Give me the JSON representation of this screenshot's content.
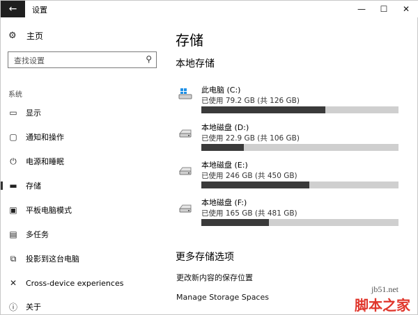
{
  "window": {
    "title": "设置",
    "back_icon": "arrow-left-icon",
    "controls": {
      "minimize": "—",
      "maximize": "☐",
      "close": "✕"
    }
  },
  "sidebar": {
    "home": {
      "label": "主页",
      "icon": "gear-icon"
    },
    "search": {
      "placeholder": "查找设置"
    },
    "group_label": "系统",
    "items": [
      {
        "label": "显示",
        "icon": "monitor-icon",
        "glyph": "▭"
      },
      {
        "label": "通知和操作",
        "icon": "notification-icon",
        "glyph": "▢"
      },
      {
        "label": "电源和睡眠",
        "icon": "power-icon",
        "glyph": "⏻"
      },
      {
        "label": "存储",
        "icon": "storage-icon",
        "glyph": "▬",
        "active": true
      },
      {
        "label": "平板电脑模式",
        "icon": "tablet-mode-icon",
        "glyph": "▣"
      },
      {
        "label": "多任务",
        "icon": "multitasking-icon",
        "glyph": "▤"
      },
      {
        "label": "投影到这台电脑",
        "icon": "project-icon",
        "glyph": "⧉"
      },
      {
        "label": "Cross-device experiences",
        "icon": "cross-device-icon",
        "glyph": "✕"
      },
      {
        "label": "关于",
        "icon": "info-icon",
        "glyph": "ⓘ"
      }
    ]
  },
  "main": {
    "title": "存储",
    "local_storage_heading": "本地存储",
    "drives": [
      {
        "name": "此电脑 (C:)",
        "usage": "已使用 79.2 GB (共 126 GB)",
        "used_fraction": 0.629,
        "icon": "windows-drive-icon"
      },
      {
        "name": "本地磁盘 (D:)",
        "usage": "已使用 22.9 GB (共 106 GB)",
        "used_fraction": 0.216,
        "icon": "hard-drive-icon"
      },
      {
        "name": "本地磁盘 (E:)",
        "usage": "已使用 246 GB (共 450 GB)",
        "used_fraction": 0.547,
        "icon": "hard-drive-icon"
      },
      {
        "name": "本地磁盘 (F:)",
        "usage": "已使用 165 GB (共 481 GB)",
        "used_fraction": 0.343,
        "icon": "hard-drive-icon"
      }
    ],
    "more_heading": "更多存储选项",
    "links": [
      {
        "label": "更改新内容的保存位置"
      },
      {
        "label": "Manage Storage Spaces"
      }
    ]
  },
  "watermark": {
    "site": "jb51.net",
    "brand": "脚本之家"
  },
  "colors": {
    "bar_fill": "#3a3a3a",
    "bar_track": "#cfcfcf",
    "back_bg": "#1f1f1f",
    "watermark_red": "#e0362c"
  }
}
